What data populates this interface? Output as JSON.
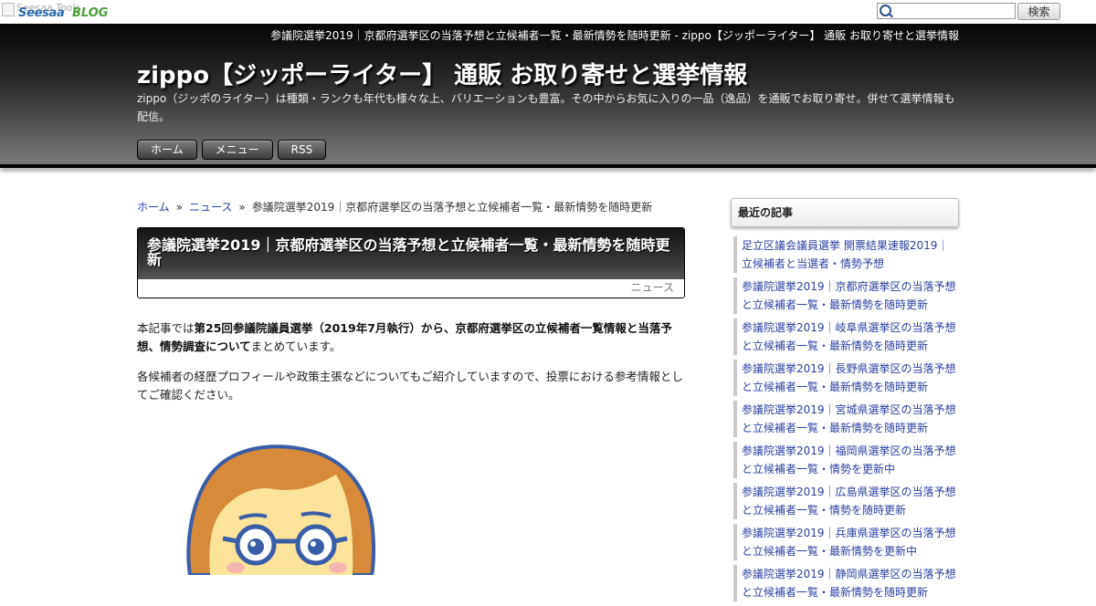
{
  "topbar": {
    "logo_alt": "Seesaa Tools",
    "logo_text_1": "Seesaa",
    "logo_text_2": "BLOG",
    "search_placeholder": "",
    "search_button": "検索"
  },
  "header": {
    "page_heading": "参議院選挙2019｜京都府選挙区の当落予想と立候補者一覧・最新情勢を随時更新 - zippo【ジッポーライター】 通販 お取り寄せと選挙情報",
    "site_title": "zippo【ジッポーライター】 通販 お取り寄せと選挙情報",
    "site_description": "zippo（ジッポのライター）は種類・ランクも年代も様々な上、バリエーションも豊富。その中からお気に入りの一品（逸品）を通販でお取り寄せ。併せて選挙情報も配信。",
    "nav": [
      "ホーム",
      "メニュー",
      "RSS"
    ]
  },
  "breadcrumb": {
    "home": "ホーム",
    "separator": "»",
    "category": "ニュース",
    "current": "参議院選挙2019｜京都府選挙区の当落予想と立候補者一覧・最新情勢を随時更新"
  },
  "article": {
    "title": "参議院選挙2019｜京都府選挙区の当落予想と立候補者一覧・最新情勢を随時更新",
    "category": "ニュース",
    "p1_pre": "本記事では",
    "p1_bold": "第25回参議院議員選挙（2019年7月執行）から、京都府選挙区の立候補者一覧情報と当落予想、情勢調査について",
    "p1_post": "まとめています。",
    "p2": "各候補者の経歴プロフィールや政策主張などについてもご紹介していますので、投票における参考情報としてご確認ください。"
  },
  "sidebar": {
    "heading": "最近の記事",
    "recent": [
      "足立区議会議員選挙 開票結果速報2019｜立候補者と当選者・情勢予想",
      "参議院選挙2019｜京都府選挙区の当落予想と立候補者一覧・最新情勢を随時更新",
      "参議院選挙2019｜岐阜県選挙区の当落予想と立候補者一覧・最新情勢を随時更新",
      "参議院選挙2019｜長野県選挙区の当落予想と立候補者一覧・最新情勢を随時更新",
      "参議院選挙2019｜宮城県選挙区の当落予想と立候補者一覧・最新情勢を随時更新",
      "参議院選挙2019｜福岡県選挙区の当落予想と立候補者一覧・情勢を更新中",
      "参議院選挙2019｜広島県選挙区の当落予想と立候補者一覧・情勢を随時更新",
      "参議院選挙2019｜兵庫県選挙区の当落予想と立候補者一覧・最新情勢を更新中",
      "参議院選挙2019｜静岡県選挙区の当落予想と立候補者一覧・最新情勢を随時更新"
    ]
  },
  "colors": {
    "link": "#2a3fa0",
    "header_top": "#050505",
    "header_bottom": "#7a7a7a"
  }
}
